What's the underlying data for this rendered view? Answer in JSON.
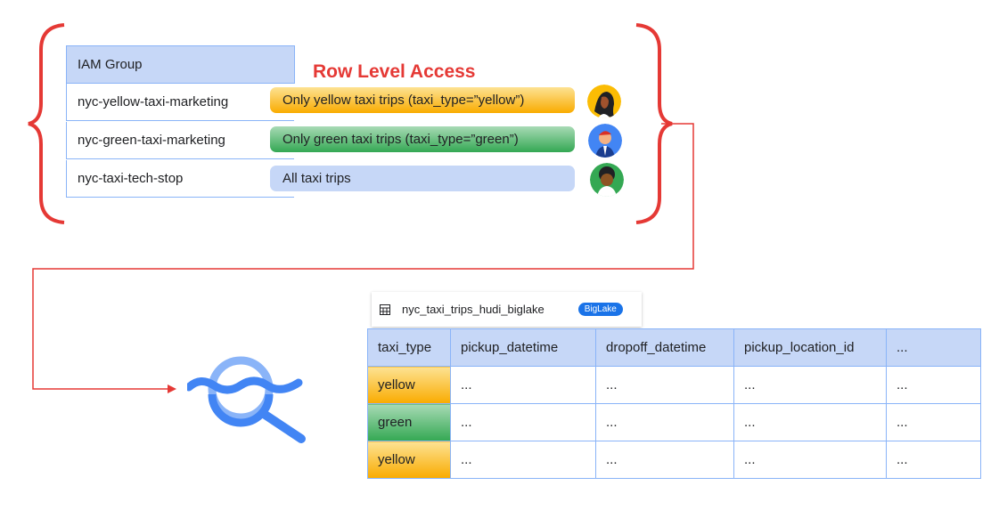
{
  "iam": {
    "header": "IAM Group",
    "groups": [
      "nyc-yellow-taxi-marketing",
      "nyc-green-taxi-marketing",
      "nyc-taxi-tech-stop"
    ]
  },
  "title": "Row Level Access",
  "policies": [
    "Only yellow taxi trips (taxi_type=”yellow”)",
    "Only green taxi trips (taxi_type=”green”)",
    "All taxi trips"
  ],
  "table": {
    "name": "nyc_taxi_trips_hudi_biglake",
    "badge": "BigLake",
    "columns": [
      "taxi_type",
      "pickup_datetime",
      "dropoff_datetime",
      "pickup_location_id",
      "..."
    ],
    "rows": [
      [
        "yellow",
        "...",
        "...",
        "...",
        "..."
      ],
      [
        "green",
        "...",
        "...",
        "...",
        "..."
      ],
      [
        "yellow",
        "...",
        "...",
        "...",
        "..."
      ]
    ]
  },
  "colors": {
    "accent_red": "#e53935",
    "table_blue": "#c6d7f7",
    "border_blue": "#8ab4f8",
    "yellow": "#f9ab00",
    "green": "#34a853",
    "logo_blue": "#4285f4"
  },
  "icons": [
    "left-brace-icon",
    "right-brace-icon",
    "connector-arrow-icon",
    "biglake-logo-icon",
    "table-grid-icon",
    "avatar-icon"
  ]
}
